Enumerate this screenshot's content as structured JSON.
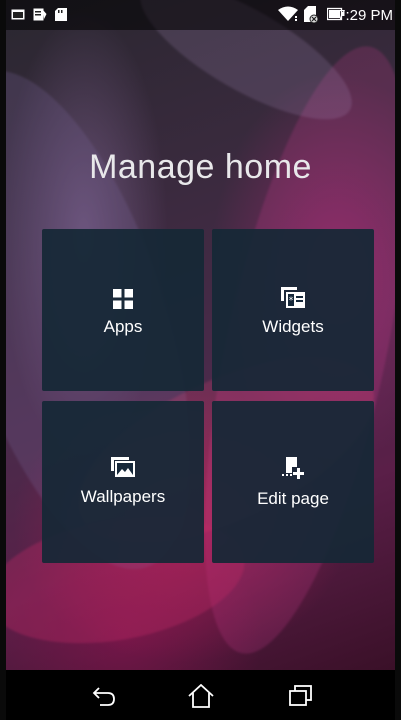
{
  "status_bar": {
    "time": "7:29 PM",
    "left_icons": [
      "message-icon",
      "notes-icon",
      "sd-card-icon"
    ],
    "right_icons": [
      "wifi-icon",
      "no-sim-icon",
      "battery-icon"
    ]
  },
  "screen": {
    "title": "Manage home"
  },
  "tiles": [
    {
      "label": "Apps",
      "icon": "apps-grid-icon"
    },
    {
      "label": "Widgets",
      "icon": "widgets-icon"
    },
    {
      "label": "Wallpapers",
      "icon": "wallpaper-icon"
    },
    {
      "label": "Edit page",
      "icon": "edit-page-icon"
    }
  ],
  "nav_bar": {
    "buttons": [
      "back-icon",
      "home-icon",
      "recents-icon"
    ]
  },
  "colors": {
    "tile_background": "#16283a",
    "title_text": "#e8e8ea",
    "nav_background": "#000000"
  }
}
